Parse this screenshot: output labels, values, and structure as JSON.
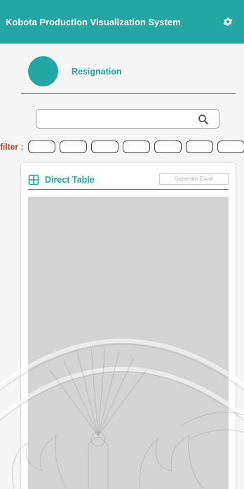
{
  "header": {
    "title": "Kobota Production Visualization System",
    "settings_icon": "gear-icon"
  },
  "profile": {
    "label": "Resignation",
    "avatar_color": "#23a7a5"
  },
  "search": {
    "placeholder": "",
    "icon": "search-icon"
  },
  "filter": {
    "label": "filter :",
    "chip_count": 7
  },
  "table_card": {
    "icon": "table-grid-icon",
    "title": "Direct Table",
    "generate_button": "Generate Excel"
  },
  "colors": {
    "accent": "#23a7a5",
    "filter_label": "#c0451c",
    "table_placeholder": "#d3d3d3"
  }
}
